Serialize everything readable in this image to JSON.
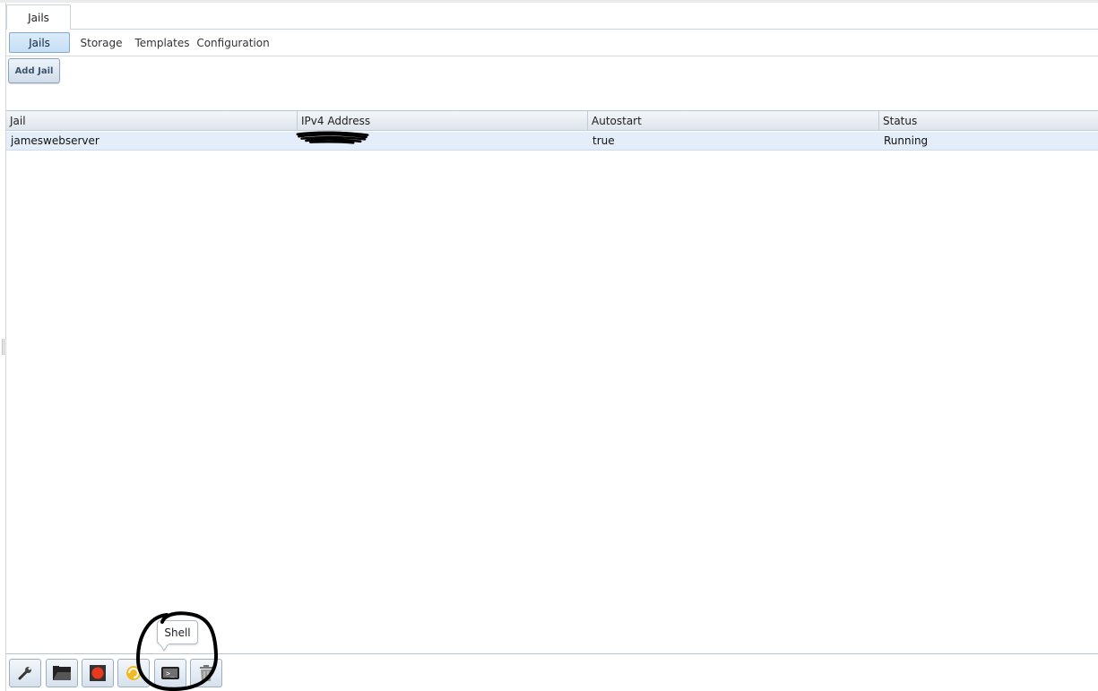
{
  "outer_tab": {
    "label": "Jails"
  },
  "subtabs": [
    {
      "label": "Jails",
      "active": true
    },
    {
      "label": "Storage",
      "active": false
    },
    {
      "label": "Templates",
      "active": false
    },
    {
      "label": "Configuration",
      "active": false
    }
  ],
  "add_button": {
    "label": "Add Jail"
  },
  "grid": {
    "columns": [
      "Jail",
      "IPv4 Address",
      "Autostart",
      "Status"
    ],
    "rows": [
      {
        "jail": "jameswebserver",
        "ipv4": "",
        "autostart": "true",
        "status": "Running"
      }
    ]
  },
  "toolbar": {
    "buttons": [
      {
        "icon": "wrench-icon"
      },
      {
        "icon": "folder-icon"
      },
      {
        "icon": "stop-icon"
      },
      {
        "icon": "restart-icon"
      },
      {
        "icon": "shell-icon"
      },
      {
        "icon": "trash-icon"
      }
    ],
    "tooltip": "Shell"
  },
  "colors": {
    "selection": "#e3eefa",
    "active_tab": "#c6dff5",
    "annotation": "#000000"
  }
}
